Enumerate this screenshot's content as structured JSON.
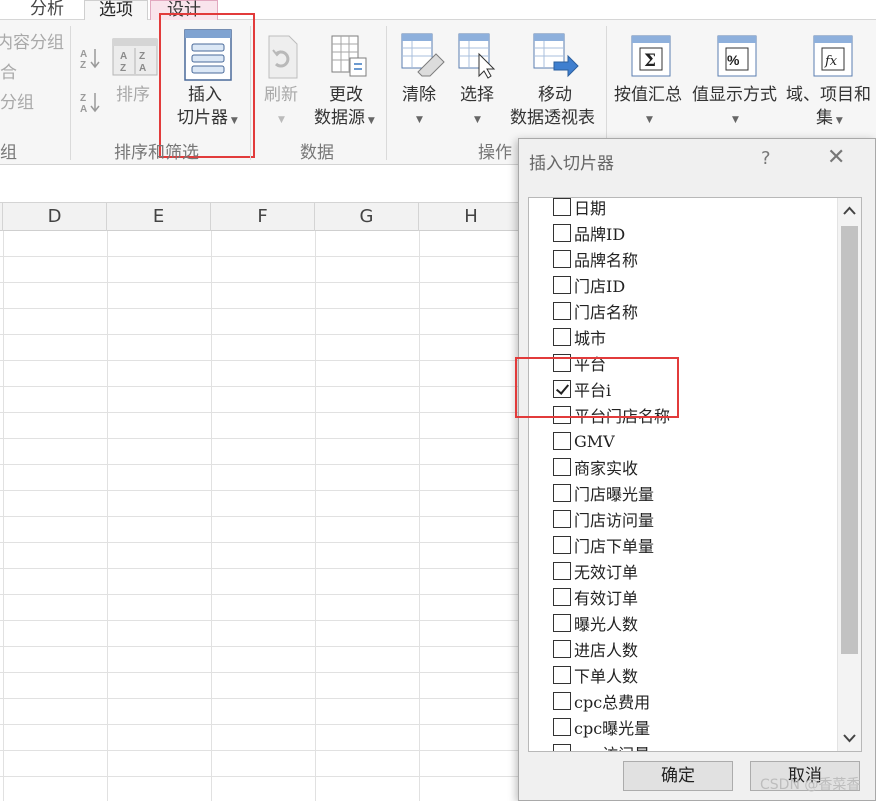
{
  "tabs": [
    {
      "label": "分析",
      "state": "normal"
    },
    {
      "label": "选项",
      "state": "active"
    },
    {
      "label": "设计",
      "state": "contextual"
    }
  ],
  "ribbon": {
    "partial_left": {
      "items": [
        "内容分组",
        "合",
        "分组"
      ],
      "group_label": "组"
    },
    "sort_filter": {
      "sort_label": "排序",
      "group_label": "排序和筛选",
      "insert_slicer": {
        "line1": "插入",
        "line2": "切片器"
      }
    },
    "data": {
      "refresh_label": "刷新",
      "change_source": {
        "line1": "更改",
        "line2": "数据源"
      },
      "group_label": "数据"
    },
    "actions": {
      "clear_label": "清除",
      "select_label": "选择",
      "move": {
        "line1": "移动",
        "line2": "数据透视表"
      },
      "group_label": "操作"
    },
    "calculations": {
      "summarize_label": "按值汇总",
      "show_values_label": "值显示方式",
      "fields_items": {
        "line1": "域、项目和",
        "line2": "集"
      }
    }
  },
  "sheet": {
    "columns": [
      "D",
      "E",
      "F",
      "G",
      "H"
    ]
  },
  "dialog": {
    "title": "插入切片器",
    "help": "?",
    "close": "✕",
    "fields": [
      {
        "label": "日期",
        "checked": false
      },
      {
        "label": "品牌ID",
        "checked": false
      },
      {
        "label": "品牌名称",
        "checked": false
      },
      {
        "label": "门店ID",
        "checked": false
      },
      {
        "label": "门店名称",
        "checked": false
      },
      {
        "label": "城市",
        "checked": false
      },
      {
        "label": "平台",
        "checked": false
      },
      {
        "label": "平台i",
        "checked": true
      },
      {
        "label": "平台门店名称",
        "checked": false
      },
      {
        "label": "GMV",
        "checked": false
      },
      {
        "label": "商家实收",
        "checked": false
      },
      {
        "label": "门店曝光量",
        "checked": false
      },
      {
        "label": "门店访问量",
        "checked": false
      },
      {
        "label": "门店下单量",
        "checked": false
      },
      {
        "label": "无效订单",
        "checked": false
      },
      {
        "label": "有效订单",
        "checked": false
      },
      {
        "label": "曝光人数",
        "checked": false
      },
      {
        "label": "进店人数",
        "checked": false
      },
      {
        "label": "下单人数",
        "checked": false
      },
      {
        "label": "cpc总费用",
        "checked": false
      },
      {
        "label": "cpc曝光量",
        "checked": false
      },
      {
        "label": "cpc访问量",
        "checked": false
      }
    ],
    "ok_label": "确定",
    "cancel_label": "取消"
  },
  "watermark": "CSDN @香菜香",
  "colors": {
    "highlight": "#e23b3b",
    "design_tab": "#f9e4ec"
  }
}
